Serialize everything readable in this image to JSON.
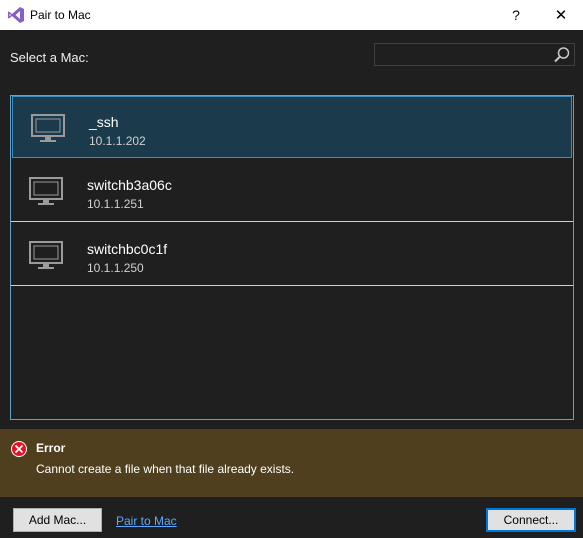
{
  "window": {
    "title": "Pair to Mac",
    "help_label": "?",
    "close_label": "✕",
    "logo_icon": "visual-studio-logo"
  },
  "header": {
    "select_label": "Select a Mac:",
    "search_value": "",
    "search_placeholder": ""
  },
  "macs": [
    {
      "name": "_ssh",
      "ip": "10.1.1.202",
      "selected": true
    },
    {
      "name": "switchb3a06c",
      "ip": "10.1.1.251",
      "selected": false
    },
    {
      "name": "switchbc0c1f",
      "ip": "10.1.1.250",
      "selected": false
    }
  ],
  "error": {
    "title": "Error",
    "message": "Cannot create a file when that file already exists.",
    "color": "#4f3f1e"
  },
  "footer": {
    "add_mac_label": "Add Mac...",
    "pair_link_label": "Pair to Mac",
    "connect_label": "Connect..."
  },
  "colors": {
    "background": "#1f1f1f",
    "selected_bg": "#1b3a4b",
    "accent": "#3b8fc0",
    "link": "#5aa8ff",
    "error_red": "#e81123"
  }
}
